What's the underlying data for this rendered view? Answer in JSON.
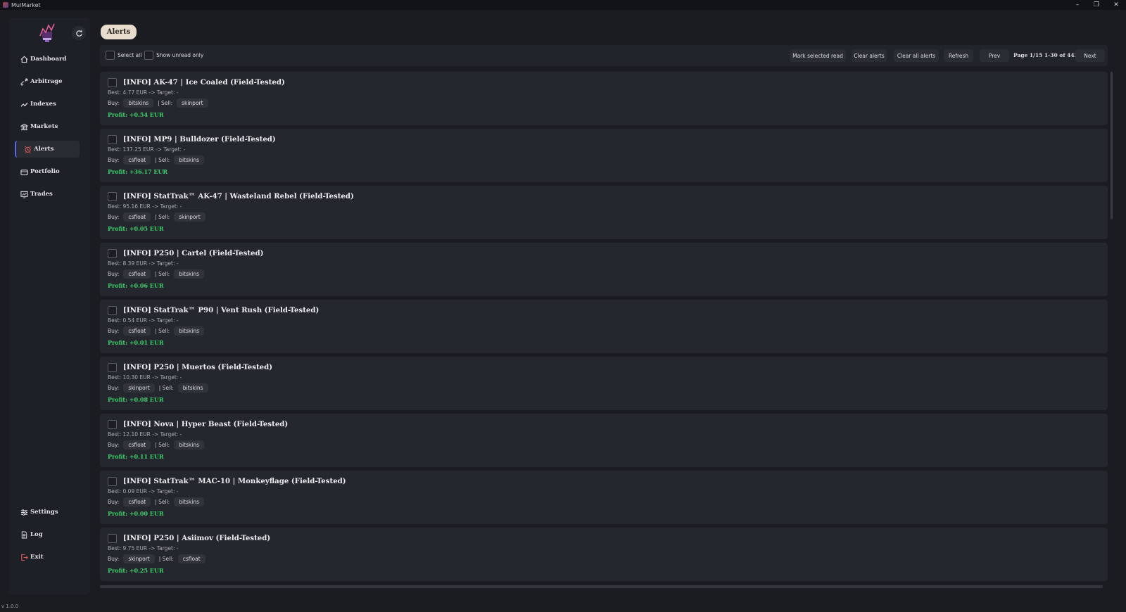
{
  "window": {
    "title": "MulMarket",
    "minimize": "–",
    "maximize": "❐",
    "close": "✕"
  },
  "sidebar": {
    "items": [
      {
        "label": "Dashboard",
        "icon": "home-icon"
      },
      {
        "label": "Arbitrage",
        "icon": "link-icon"
      },
      {
        "label": "Indexes",
        "icon": "trend-icon"
      },
      {
        "label": "Markets",
        "icon": "bank-icon"
      },
      {
        "label": "Alerts",
        "icon": "alarm-icon",
        "active": true
      },
      {
        "label": "Portfolio",
        "icon": "wallet-icon"
      },
      {
        "label": "Trades",
        "icon": "chart-icon"
      }
    ],
    "bottom": [
      {
        "label": "Settings",
        "icon": "sliders-icon"
      },
      {
        "label": "Log",
        "icon": "document-icon"
      },
      {
        "label": "Exit",
        "icon": "exit-icon"
      }
    ]
  },
  "version": "v 1.0.0",
  "tab": "Alerts",
  "toolbar": {
    "select_all": "Select all",
    "unread_only": "Show unread only",
    "mark_read": "Mark selected read",
    "clear_alerts": "Clear alerts",
    "clear_all": "Clear all alerts",
    "refresh": "Refresh",
    "prev": "Prev",
    "page_info": "Page 1/15  1-30 of 443",
    "next": "Next"
  },
  "labels": {
    "buy": "Buy:",
    "sell": "| Sell:"
  },
  "alerts": [
    {
      "title": "[INFO] AK-47 | Ice Coaled (Field-Tested)",
      "best": "Best: 4.77 EUR  ->  Target: -",
      "buy": "bitskins",
      "sell": "skinport",
      "profit": "Profit: +0.54 EUR"
    },
    {
      "title": "[INFO] MP9 | Bulldozer (Field-Tested)",
      "best": "Best: 137.25 EUR  ->  Target: -",
      "buy": "csfloat",
      "sell": "bitskins",
      "profit": "Profit: +36.17 EUR"
    },
    {
      "title": "[INFO] StatTrak™ AK-47 | Wasteland Rebel (Field-Tested)",
      "best": "Best: 95.16 EUR  ->  Target: -",
      "buy": "csfloat",
      "sell": "skinport",
      "profit": "Profit: +0.05 EUR"
    },
    {
      "title": "[INFO] P250 | Cartel (Field-Tested)",
      "best": "Best: 8.39 EUR  ->  Target: -",
      "buy": "csfloat",
      "sell": "bitskins",
      "profit": "Profit: +0.06 EUR"
    },
    {
      "title": "[INFO] StatTrak™ P90 | Vent Rush (Field-Tested)",
      "best": "Best: 0.54 EUR  ->  Target: -",
      "buy": "csfloat",
      "sell": "bitskins",
      "profit": "Profit: +0.01 EUR"
    },
    {
      "title": "[INFO] P250 | Muertos (Field-Tested)",
      "best": "Best: 10.30 EUR  ->  Target: -",
      "buy": "skinport",
      "sell": "bitskins",
      "profit": "Profit: +0.08 EUR"
    },
    {
      "title": "[INFO] Nova | Hyper Beast (Field-Tested)",
      "best": "Best: 12.10 EUR  ->  Target: -",
      "buy": "csfloat",
      "sell": "bitskins",
      "profit": "Profit: +0.11 EUR"
    },
    {
      "title": "[INFO] StatTrak™ MAC-10 | Monkeyflage (Field-Tested)",
      "best": "Best: 0.09 EUR  ->  Target: -",
      "buy": "csfloat",
      "sell": "bitskins",
      "profit": "Profit: +0.00 EUR"
    },
    {
      "title": "[INFO] P250 | Asiimov (Field-Tested)",
      "best": "Best: 9.75 EUR  ->  Target: -",
      "buy": "skinport",
      "sell": "csfloat",
      "profit": "Profit: +0.25 EUR"
    }
  ]
}
